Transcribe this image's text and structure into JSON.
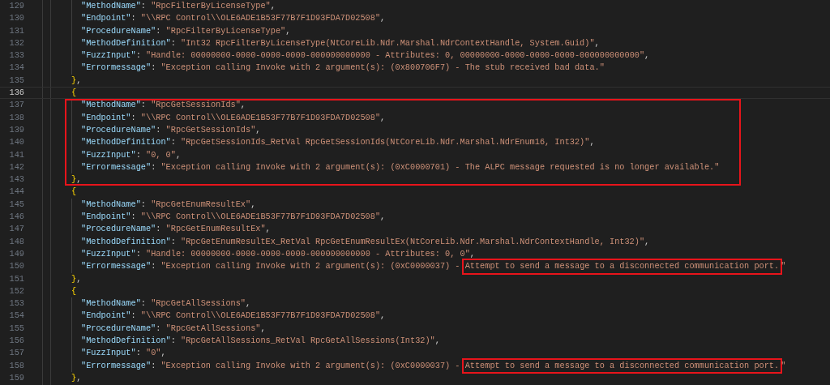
{
  "editor": {
    "objects": [
      {
        "highlighted": false,
        "members": [
          {
            "number": "129",
            "current": false,
            "key": "\"MethodName\"",
            "colon": ": ",
            "value": [
              {
                "text": "\"RpcFilterByLicenseType\"",
                "marked": false
              }
            ],
            "comma": ","
          },
          {
            "number": "130",
            "current": false,
            "key": "\"Endpoint\"",
            "colon": ": ",
            "value": [
              {
                "text": "\"\\\\RPC Control\\\\OLE6ADE1B53F77B7F1D93FDA7D02508\"",
                "marked": false
              }
            ],
            "comma": ","
          },
          {
            "number": "131",
            "current": false,
            "key": "\"ProcedureName\"",
            "colon": ": ",
            "value": [
              {
                "text": "\"RpcFilterByLicenseType\"",
                "marked": false
              }
            ],
            "comma": ","
          },
          {
            "number": "132",
            "current": false,
            "key": "\"MethodDefinition\"",
            "colon": ": ",
            "value": [
              {
                "text": "\"Int32 RpcFilterByLicenseType(NtCoreLib.Ndr.Marshal.NdrContextHandle, System.Guid)\"",
                "marked": false
              }
            ],
            "comma": ","
          },
          {
            "number": "133",
            "current": false,
            "key": "\"FuzzInput\"",
            "colon": ": ",
            "value": [
              {
                "text": "\"Handle: 00000000-0000-0000-0000-000000000000 - Attributes: 0, 00000000-0000-0000-0000-000000000000\"",
                "marked": false
              }
            ],
            "comma": ","
          },
          {
            "number": "134",
            "current": false,
            "key": "\"Errormessage\"",
            "colon": ": ",
            "value": [
              {
                "text": "\"Exception calling Invoke with 2 argument(s): (0x800706F7) - The stub received bad data.\"",
                "marked": false
              }
            ]
          }
        ],
        "close_line": {
          "number": "135",
          "current": false,
          "brace": "}",
          "comma": ","
        }
      },
      {
        "open_line": {
          "number": "136",
          "current": true,
          "brace": "{"
        },
        "highlighted": true,
        "members": [
          {
            "number": "137",
            "current": false,
            "key": "\"MethodName\"",
            "colon": ": ",
            "value": [
              {
                "text": "\"RpcGetSessionIds\"",
                "marked": false
              }
            ],
            "comma": ","
          },
          {
            "number": "138",
            "current": false,
            "key": "\"Endpoint\"",
            "colon": ": ",
            "value": [
              {
                "text": "\"\\\\RPC Control\\\\OLE6ADE1B53F77B7F1D93FDA7D02508\"",
                "marked": false
              }
            ],
            "comma": ","
          },
          {
            "number": "139",
            "current": false,
            "key": "\"ProcedureName\"",
            "colon": ": ",
            "value": [
              {
                "text": "\"RpcGetSessionIds\"",
                "marked": false
              }
            ],
            "comma": ","
          },
          {
            "number": "140",
            "current": false,
            "key": "\"MethodDefinition\"",
            "colon": ": ",
            "value": [
              {
                "text": "\"RpcGetSessionIds_RetVal RpcGetSessionIds(NtCoreLib.Ndr.Marshal.NdrEnum16, Int32)\"",
                "marked": false
              }
            ],
            "comma": ","
          },
          {
            "number": "141",
            "current": false,
            "key": "\"FuzzInput\"",
            "colon": ": ",
            "value": [
              {
                "text": "\"0, 0\"",
                "marked": false
              }
            ],
            "comma": ","
          },
          {
            "number": "142",
            "current": false,
            "key": "\"Errormessage\"",
            "colon": ": ",
            "value": [
              {
                "text": "\"Exception calling Invoke with 2 argument(s): (0xC0000701) - The ALPC message requested is no longer available.\"",
                "marked": false
              }
            ]
          }
        ],
        "close_line": {
          "number": "143",
          "current": false,
          "brace": "}",
          "comma": ","
        }
      },
      {
        "open_line": {
          "number": "144",
          "current": false,
          "brace": "{"
        },
        "highlighted": false,
        "members": [
          {
            "number": "145",
            "current": false,
            "key": "\"MethodName\"",
            "colon": ": ",
            "value": [
              {
                "text": "\"RpcGetEnumResultEx\"",
                "marked": false
              }
            ],
            "comma": ","
          },
          {
            "number": "146",
            "current": false,
            "key": "\"Endpoint\"",
            "colon": ": ",
            "value": [
              {
                "text": "\"\\\\RPC Control\\\\OLE6ADE1B53F77B7F1D93FDA7D02508\"",
                "marked": false
              }
            ],
            "comma": ","
          },
          {
            "number": "147",
            "current": false,
            "key": "\"ProcedureName\"",
            "colon": ": ",
            "value": [
              {
                "text": "\"RpcGetEnumResultEx\"",
                "marked": false
              }
            ],
            "comma": ","
          },
          {
            "number": "148",
            "current": false,
            "key": "\"MethodDefinition\"",
            "colon": ": ",
            "value": [
              {
                "text": "\"RpcGetEnumResultEx_RetVal RpcGetEnumResultEx(NtCoreLib.Ndr.Marshal.NdrContextHandle, Int32)\"",
                "marked": false
              }
            ],
            "comma": ","
          },
          {
            "number": "149",
            "current": false,
            "key": "\"FuzzInput\"",
            "colon": ": ",
            "value": [
              {
                "text": "\"Handle: 00000000-0000-0000-0000-000000000000 - Attributes: 0, 0\"",
                "marked": false
              }
            ],
            "comma": ","
          },
          {
            "number": "150",
            "current": false,
            "key": "\"Errormessage\"",
            "colon": ": ",
            "value": [
              {
                "text": "\"Exception calling Invoke with 2 argument(s): (0xC0000037) - ",
                "marked": false
              },
              {
                "text": "Attempt to send a message to a disconnected communication port.",
                "marked": true
              },
              {
                "text": "\"",
                "marked": false
              }
            ]
          }
        ],
        "close_line": {
          "number": "151",
          "current": false,
          "brace": "}",
          "comma": ","
        }
      },
      {
        "open_line": {
          "number": "152",
          "current": false,
          "brace": "{"
        },
        "highlighted": false,
        "members": [
          {
            "number": "153",
            "current": false,
            "key": "\"MethodName\"",
            "colon": ": ",
            "value": [
              {
                "text": "\"RpcGetAllSessions\"",
                "marked": false
              }
            ],
            "comma": ","
          },
          {
            "number": "154",
            "current": false,
            "key": "\"Endpoint\"",
            "colon": ": ",
            "value": [
              {
                "text": "\"\\\\RPC Control\\\\OLE6ADE1B53F77B7F1D93FDA7D02508\"",
                "marked": false
              }
            ],
            "comma": ","
          },
          {
            "number": "155",
            "current": false,
            "key": "\"ProcedureName\"",
            "colon": ": ",
            "value": [
              {
                "text": "\"RpcGetAllSessions\"",
                "marked": false
              }
            ],
            "comma": ","
          },
          {
            "number": "156",
            "current": false,
            "key": "\"MethodDefinition\"",
            "colon": ": ",
            "value": [
              {
                "text": "\"RpcGetAllSessions_RetVal RpcGetAllSessions(Int32)\"",
                "marked": false
              }
            ],
            "comma": ","
          },
          {
            "number": "157",
            "current": false,
            "key": "\"FuzzInput\"",
            "colon": ": ",
            "value": [
              {
                "text": "\"0\"",
                "marked": false
              }
            ],
            "comma": ","
          },
          {
            "number": "158",
            "current": false,
            "key": "\"Errormessage\"",
            "colon": ": ",
            "value": [
              {
                "text": "\"Exception calling Invoke with 2 argument(s): (0xC0000037) - ",
                "marked": false
              },
              {
                "text": "Attempt to send a message to a disconnected communication port.",
                "marked": true
              },
              {
                "text": "\"",
                "marked": false
              }
            ]
          }
        ],
        "close_line": {
          "number": "159",
          "current": false,
          "brace": "}",
          "comma": ","
        }
      }
    ]
  }
}
